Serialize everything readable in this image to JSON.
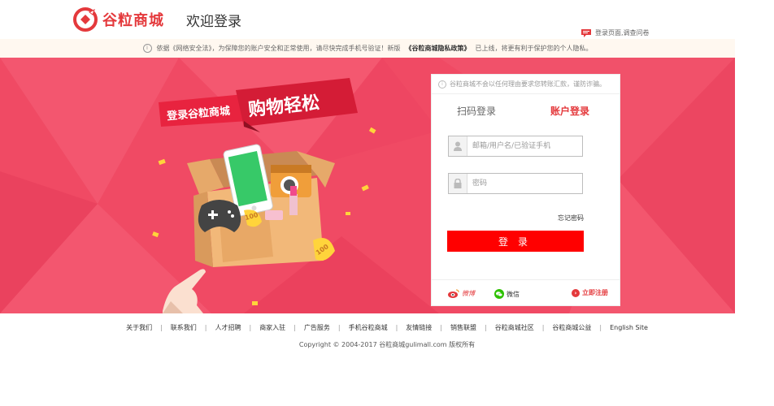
{
  "header": {
    "logo_text": "谷粒商城",
    "welcome": "欢迎登录",
    "survey_link": "登录页面,调查问卷"
  },
  "notice": {
    "prefix": "依据《网络安全法》，为保障您的账户安全和正常使用，请尽快完成手机号验证！新版",
    "policy": "《谷粒商城隐私政策》",
    "suffix": "已上线，将更有利于保护您的个人隐私。"
  },
  "banner": {
    "slogan_left": "登录谷粒商城",
    "slogan_right": "购物轻松",
    "badge_text_1": "100",
    "badge_text_2": "100"
  },
  "login": {
    "tip": "谷粒商城不会以任何理由要求您转账汇款，谨防诈骗。",
    "tab_qr": "扫码登录",
    "tab_account": "账户登录",
    "username_placeholder": "邮箱/用户名/已验证手机",
    "password_placeholder": "密码",
    "forgot": "忘记密码",
    "submit": "登录",
    "weibo": "微博",
    "wechat": "微信",
    "register": "立即注册"
  },
  "footer": {
    "links": [
      "关于我们",
      "联系我们",
      "人才招聘",
      "商家入驻",
      "广告服务",
      "手机谷粒商城",
      "友情链接",
      "销售联盟",
      "谷粒商城社区",
      "谷粒商城公益",
      "English Site"
    ],
    "copyright": "Copyright © 2004-2017 谷粒商城gulimall.com 版权所有"
  },
  "colors": {
    "brand": "#e4393c",
    "banner": "#f04a64",
    "login_button": "#ff0000"
  }
}
